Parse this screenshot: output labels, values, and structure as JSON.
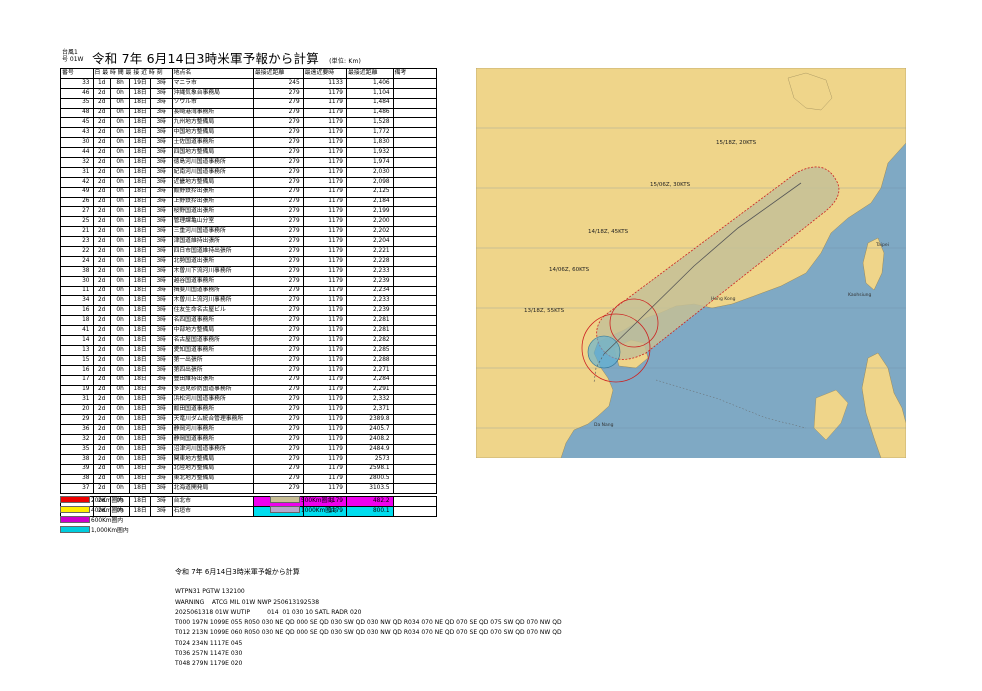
{
  "header": {
    "typhoon_label_line1": "台風1",
    "typhoon_label_line2": "号 01W",
    "title": "令和 7年 6月14日3時米軍予報から計算",
    "unit": "(単位: Km)"
  },
  "table": {
    "columns": [
      "番号",
      "日 最 時 間 最 接 近 時 刻",
      "",
      "最接近日",
      "地点名",
      "最接近距離",
      "最遠近要時",
      "最接近距離",
      "備考"
    ],
    "rows": [
      {
        "no": "33",
        "a": "1d",
        "b": "8h",
        "day": "19日",
        "time": "3時",
        "name": "マニラ市",
        "d1": "245",
        "d2": "1133",
        "d3": "1,406"
      },
      {
        "no": "46",
        "a": "2d",
        "b": "0h",
        "day": "18日",
        "time": "3時",
        "name": "沖縄気象台事務局",
        "d1": "279",
        "d2": "1179",
        "d3": "1,104"
      },
      {
        "no": "35",
        "a": "2d",
        "b": "0h",
        "day": "18日",
        "time": "3時",
        "name": "ソウル市",
        "d1": "279",
        "d2": "1179",
        "d3": "1,484"
      },
      {
        "no": "48",
        "a": "2d",
        "b": "0h",
        "day": "18日",
        "time": "3時",
        "name": "長崎港湾事務所",
        "d1": "279",
        "d2": "1179",
        "d3": "1,486"
      },
      {
        "no": "45",
        "a": "2d",
        "b": "0h",
        "day": "18日",
        "time": "3時",
        "name": "九州地方整備局",
        "d1": "279",
        "d2": "1179",
        "d3": "1,528"
      },
      {
        "no": "43",
        "a": "2d",
        "b": "0h",
        "day": "18日",
        "time": "3時",
        "name": "中国地方整備局",
        "d1": "279",
        "d2": "1179",
        "d3": "1,772"
      },
      {
        "no": "30",
        "a": "2d",
        "b": "0h",
        "day": "18日",
        "time": "3時",
        "name": "土佐国道事務所",
        "d1": "279",
        "d2": "1179",
        "d3": "1,830"
      },
      {
        "no": "44",
        "a": "2d",
        "b": "0h",
        "day": "18日",
        "time": "3時",
        "name": "四国地方整備局",
        "d1": "279",
        "d2": "1179",
        "d3": "1,932"
      },
      {
        "no": "32",
        "a": "2d",
        "b": "0h",
        "day": "18日",
        "time": "3時",
        "name": "徳島河川国道事務所",
        "d1": "279",
        "d2": "1179",
        "d3": "1,974"
      },
      {
        "no": "31",
        "a": "2d",
        "b": "0h",
        "day": "18日",
        "time": "3時",
        "name": "紀南河川国道事務所",
        "d1": "279",
        "d2": "1179",
        "d3": "2,030"
      },
      {
        "no": "42",
        "a": "2d",
        "b": "0h",
        "day": "18日",
        "time": "3時",
        "name": "近畿地方整備局",
        "d1": "279",
        "d2": "1179",
        "d3": "2,098"
      },
      {
        "no": "49",
        "a": "2d",
        "b": "0h",
        "day": "18日",
        "time": "3時",
        "name": "飯野鉄拎出張所",
        "d1": "279",
        "d2": "1179",
        "d3": "2,125"
      },
      {
        "no": "26",
        "a": "2d",
        "b": "0h",
        "day": "18日",
        "time": "3時",
        "name": "上野鉄拎出張所",
        "d1": "279",
        "d2": "1179",
        "d3": "2,184"
      },
      {
        "no": "27",
        "a": "2d",
        "b": "0h",
        "day": "18日",
        "time": "3時",
        "name": "桜野国道出張所",
        "d1": "279",
        "d2": "1179",
        "d3": "2,199"
      },
      {
        "no": "25",
        "a": "2d",
        "b": "0h",
        "day": "18日",
        "time": "3時",
        "name": "管理課亀山分室",
        "d1": "279",
        "d2": "1179",
        "d3": "2,200"
      },
      {
        "no": "21",
        "a": "2d",
        "b": "0h",
        "day": "18日",
        "time": "3時",
        "name": "三重河川国道事務所",
        "d1": "279",
        "d2": "1179",
        "d3": "2,202"
      },
      {
        "no": "23",
        "a": "2d",
        "b": "0h",
        "day": "18日",
        "time": "3時",
        "name": "津国道維持出張所",
        "d1": "279",
        "d2": "1179",
        "d3": "2,204"
      },
      {
        "no": "22",
        "a": "2d",
        "b": "0h",
        "day": "18日",
        "time": "3時",
        "name": "四日市国道維持出張所",
        "d1": "279",
        "d2": "1179",
        "d3": "2,221"
      },
      {
        "no": "24",
        "a": "2d",
        "b": "0h",
        "day": "18日",
        "time": "3時",
        "name": "北勢国道出張所",
        "d1": "279",
        "d2": "1179",
        "d3": "2,228"
      },
      {
        "no": "38",
        "a": "2d",
        "b": "0h",
        "day": "18日",
        "time": "3時",
        "name": "木曽川下流河川事務所",
        "d1": "279",
        "d2": "1179",
        "d3": "2,233"
      },
      {
        "no": "30",
        "a": "2d",
        "b": "0h",
        "day": "18日",
        "time": "3時",
        "name": "越谷国道事務所",
        "d1": "279",
        "d2": "1179",
        "d3": "2,239"
      },
      {
        "no": "11",
        "a": "2d",
        "b": "0h",
        "day": "18日",
        "time": "3時",
        "name": "揖斐川国道事務所",
        "d1": "279",
        "d2": "1179",
        "d3": "2,234"
      },
      {
        "no": "34",
        "a": "2d",
        "b": "0h",
        "day": "18日",
        "time": "3時",
        "name": "木曽川上流河川事務所",
        "d1": "279",
        "d2": "1179",
        "d3": "2,233"
      },
      {
        "no": "16",
        "a": "2d",
        "b": "0h",
        "day": "18日",
        "time": "3時",
        "name": "住友生命名古屋ビル",
        "d1": "279",
        "d2": "1179",
        "d3": "2,239"
      },
      {
        "no": "18",
        "a": "2d",
        "b": "0h",
        "day": "18日",
        "time": "3時",
        "name": "名四国道事務所",
        "d1": "279",
        "d2": "1179",
        "d3": "2,281"
      },
      {
        "no": "41",
        "a": "2d",
        "b": "0h",
        "day": "18日",
        "time": "3時",
        "name": "中部地方整備局",
        "d1": "279",
        "d2": "1179",
        "d3": "2,281"
      },
      {
        "no": "14",
        "a": "2d",
        "b": "0h",
        "day": "18日",
        "time": "3時",
        "name": "名古屋国道事務所",
        "d1": "279",
        "d2": "1179",
        "d3": "2,282"
      },
      {
        "no": "13",
        "a": "2d",
        "b": "0h",
        "day": "18日",
        "time": "3時",
        "name": "愛知国道事務所",
        "d1": "279",
        "d2": "1179",
        "d3": "2,285"
      },
      {
        "no": "15",
        "a": "2d",
        "b": "0h",
        "day": "18日",
        "time": "3時",
        "name": "第一出張所",
        "d1": "279",
        "d2": "1179",
        "d3": "2,288"
      },
      {
        "no": "16",
        "a": "2d",
        "b": "0h",
        "day": "18日",
        "time": "3時",
        "name": "第四出張所",
        "d1": "279",
        "d2": "1179",
        "d3": "2,271"
      },
      {
        "no": "17",
        "a": "2d",
        "b": "0h",
        "day": "18日",
        "time": "3時",
        "name": "豊田維持出張所",
        "d1": "279",
        "d2": "1179",
        "d3": "2,284"
      },
      {
        "no": "19",
        "a": "2d",
        "b": "0h",
        "day": "18日",
        "time": "3時",
        "name": "多治見砂防国道事務所",
        "d1": "279",
        "d2": "1179",
        "d3": "2,291"
      },
      {
        "no": "31",
        "a": "2d",
        "b": "0h",
        "day": "18日",
        "time": "3時",
        "name": "浜松河川国道事務所",
        "d1": "279",
        "d2": "1179",
        "d3": "2,332"
      },
      {
        "no": "20",
        "a": "2d",
        "b": "0h",
        "day": "18日",
        "time": "3時",
        "name": "飯田国道事務所",
        "d1": "279",
        "d2": "1179",
        "d3": "2,371"
      },
      {
        "no": "29",
        "a": "2d",
        "b": "0h",
        "day": "18日",
        "time": "3時",
        "name": "天竜川ダム統合管理事務所",
        "d1": "279",
        "d2": "1179",
        "d3": "2389.8"
      },
      {
        "no": "36",
        "a": "2d",
        "b": "0h",
        "day": "18日",
        "time": "3時",
        "name": "静岡河川事務所",
        "d1": "279",
        "d2": "1179",
        "d3": "2405.7"
      },
      {
        "no": "32",
        "a": "2d",
        "b": "0h",
        "day": "18日",
        "time": "3時",
        "name": "静岡国道事務所",
        "d1": "279",
        "d2": "1179",
        "d3": "2408.2"
      },
      {
        "no": "35",
        "a": "2d",
        "b": "0h",
        "day": "18日",
        "time": "3時",
        "name": "沼津河川国道事務所",
        "d1": "279",
        "d2": "1179",
        "d3": "2484.9"
      },
      {
        "no": "38",
        "a": "2d",
        "b": "0h",
        "day": "18日",
        "time": "3時",
        "name": "関東地方整備局",
        "d1": "279",
        "d2": "1179",
        "d3": "2573"
      },
      {
        "no": "39",
        "a": "2d",
        "b": "0h",
        "day": "18日",
        "time": "3時",
        "name": "北陸地方整備局",
        "d1": "279",
        "d2": "1179",
        "d3": "2598.1"
      },
      {
        "no": "38",
        "a": "2d",
        "b": "0h",
        "day": "18日",
        "time": "3時",
        "name": "東北地方整備局",
        "d1": "279",
        "d2": "1179",
        "d3": "2800.5"
      },
      {
        "no": "37",
        "a": "2d",
        "b": "0h",
        "day": "18日",
        "time": "3時",
        "name": "北海道開発局",
        "d1": "279",
        "d2": "1179",
        "d3": "3103.5"
      }
    ],
    "highlight_rows": [
      {
        "no": "47",
        "a": "2d",
        "b": "0h",
        "day": "18日",
        "time": "3時",
        "name": "台北市",
        "d1": "279",
        "d2": "1179",
        "d3": "482.2",
        "color": "magenta"
      },
      {
        "no": "34",
        "a": "2d",
        "b": "0h",
        "day": "18日",
        "time": "3時",
        "name": "石垣市",
        "d1": "279",
        "d2": "1179",
        "d3": "800.1",
        "color": "cyan"
      }
    ]
  },
  "legend": {
    "items": [
      {
        "label": "200Km圏内",
        "color": "#ee0000"
      },
      {
        "label": "400Km圏内",
        "color": "#ffee00"
      },
      {
        "label": "600Km圏内",
        "color": "#cc00cc"
      },
      {
        "label": "1,000Km圏内",
        "color": "#00ccdd"
      },
      {
        "label": "500Km圏内",
        "color": "#c8bf94"
      },
      {
        "label": "1000Km圏内",
        "color": "#b7a6cc"
      }
    ]
  },
  "map": {
    "colors": {
      "sea": "#7fa9c4",
      "land": "#efd58a",
      "cone": "#c4bf96",
      "radius_red": "#cc2222",
      "ring_blue": "#5fb0d4"
    },
    "track_labels": [
      "15/18Z, 20KTS",
      "15/06Z, 30KTS",
      "14/18Z, 45KTS",
      "14/06Z, 60KTS",
      "13/18Z, 55KTS"
    ],
    "place_labels": [
      "Taipei",
      "Kaohsiung",
      "Hong Kong",
      "Da Nang"
    ]
  },
  "warning": {
    "title": "令和 7年 6月14日3時米軍予報から計算",
    "lines": [
      "WTPN31 PGTW 132100",
      "WARNING    ATCG MIL 01W NWP 250613192538",
      "2025061318 01W WUTIP         014  01 030 10 SATL RADR 020",
      "T000 197N 1099E 055 R050 030 NE QD 000 SE QD 030 SW QD 030 NW QD R034 070 NE QD 070 SE QD 075 SW QD 070 NW QD",
      "T012 213N 1099E 060 R050 030 NE QD 000 SE QD 030 SW QD 030 NW QD R034 070 NE QD 070 SE QD 070 SW QD 070 NW QD",
      "T024 234N 1117E 045",
      "T036 257N 1147E 030",
      "T048 279N 1179E 020"
    ]
  }
}
